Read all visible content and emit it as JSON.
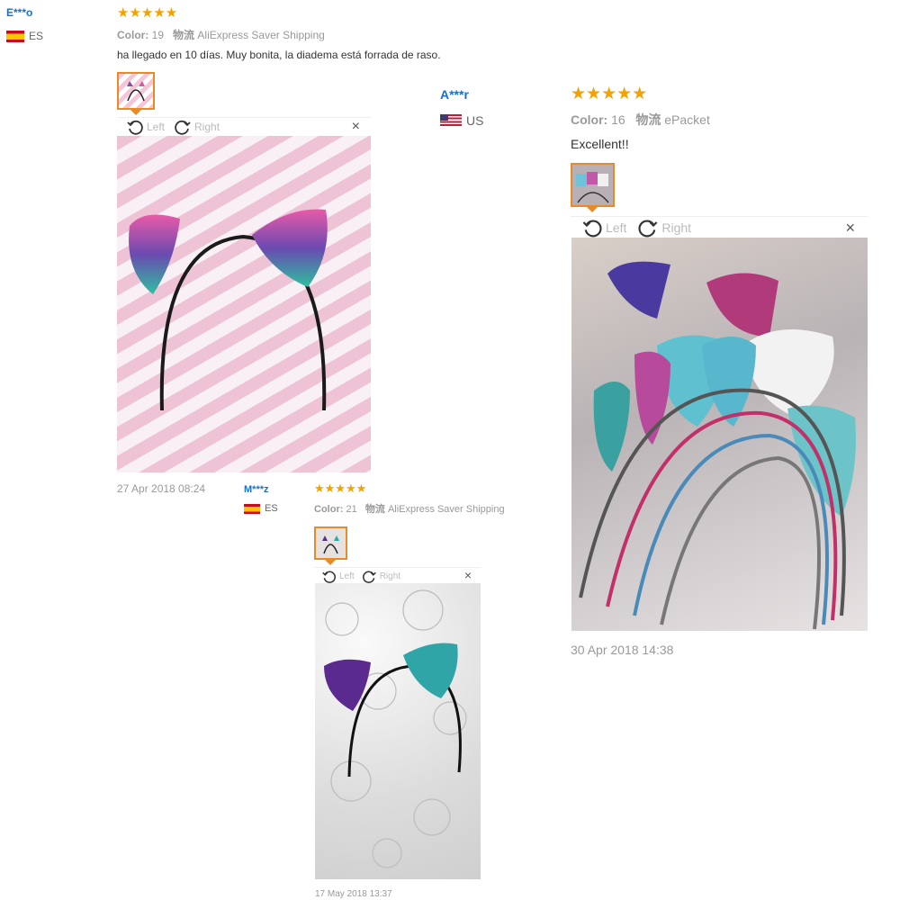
{
  "reviews": [
    {
      "user": "E***o",
      "country": "ES",
      "stars": "★★★★★",
      "color_label": "Color:",
      "color_value": "19",
      "shipping_label": "物流",
      "shipping_value": "AliExpress Saver Shipping",
      "text": "ha llegado en 10 días. Muy bonita, la diadema está forrada de raso.",
      "toolbar": {
        "left": "Left",
        "right": "Right",
        "close": "×"
      },
      "date": "27 Apr 2018 08:24"
    },
    {
      "user": "A***r",
      "country": "US",
      "stars": "★★★★★",
      "color_label": "Color:",
      "color_value": "16",
      "shipping_label": "物流",
      "shipping_value": "ePacket",
      "text": "Excellent!!",
      "toolbar": {
        "left": "Left",
        "right": "Right",
        "close": "×"
      },
      "date": "30 Apr 2018 14:38"
    },
    {
      "user": "M***z",
      "country": "ES",
      "stars": "★★★★★",
      "color_label": "Color:",
      "color_value": "21",
      "shipping_label": "物流",
      "shipping_value": "AliExpress Saver Shipping",
      "toolbar": {
        "left": "Left",
        "right": "Right",
        "close": "×"
      },
      "date": "17 May 2018 13:37"
    }
  ],
  "colors": {
    "username": "#1a6fc9",
    "star": "#f5a100",
    "thumb_border": "#e78b29"
  }
}
